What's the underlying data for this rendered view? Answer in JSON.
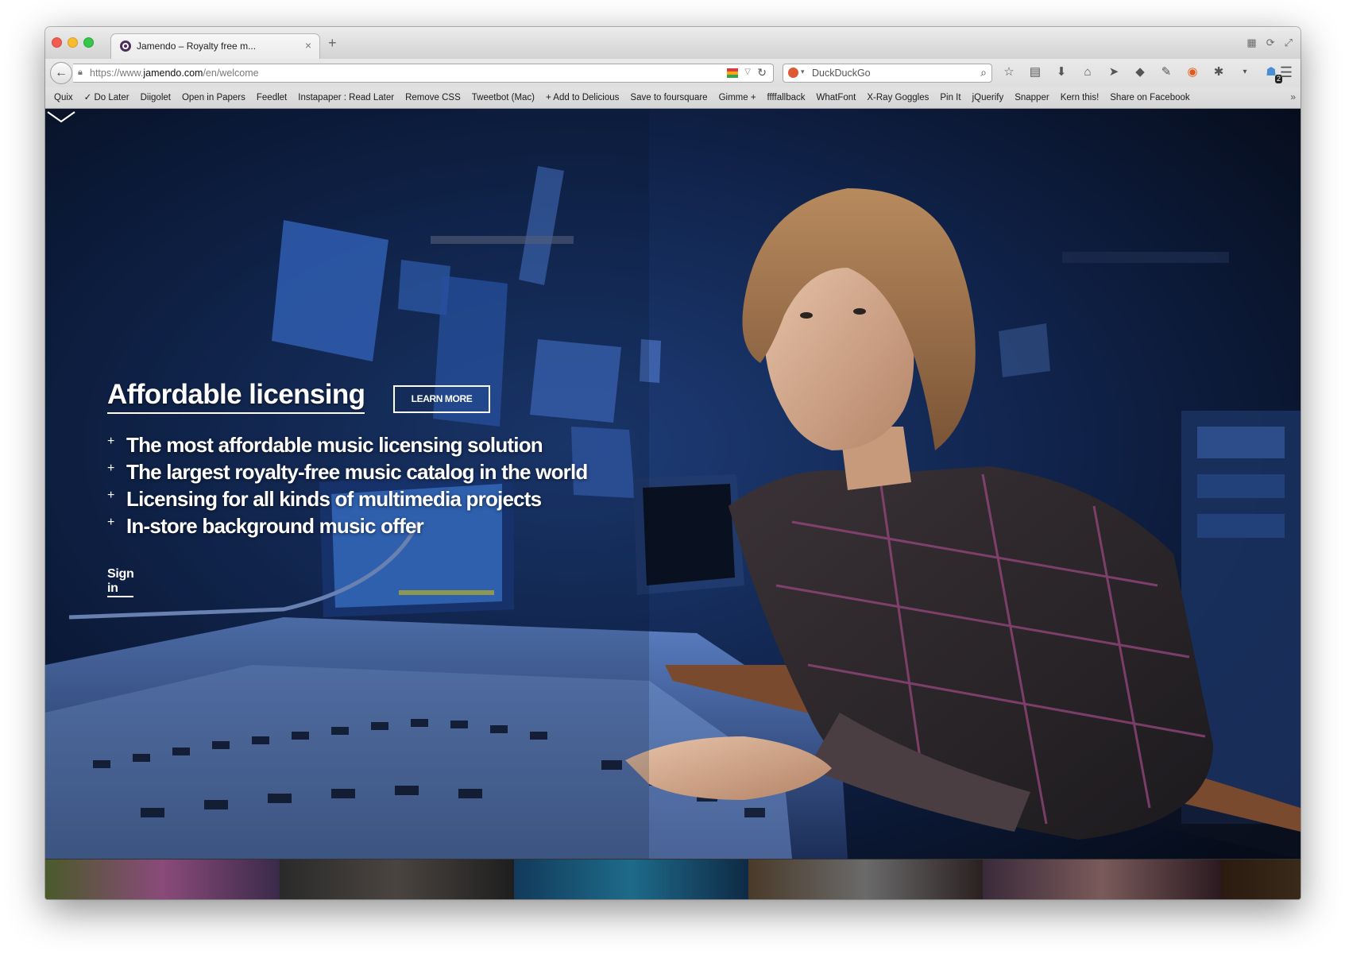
{
  "browser": {
    "tab": {
      "title": "Jamendo – Royalty free m...",
      "close": "×"
    },
    "new_tab": "+",
    "url": {
      "prefix": "https://www.",
      "domain": "jamendo.com",
      "path": "/en/welcome"
    },
    "search": {
      "engine": "DuckDuckGo",
      "placeholder": "DuckDuckGo"
    },
    "addon_badge_count": "2",
    "bookmarks": [
      "Quix",
      "✓ Do Later",
      "Diigolet",
      "Open in Papers",
      "Feedlet",
      "Instapaper : Read Later",
      "Remove CSS",
      "Tweetbot (Mac)",
      "+ Add to Delicious",
      "Save to foursquare",
      "Gimme +",
      "ffffallback",
      "WhatFont",
      "X-Ray Goggles",
      "Pin It",
      "jQuerify",
      "Snapper",
      "Kern this!",
      "Share on Facebook"
    ],
    "bookmarks_overflow": "»"
  },
  "hero": {
    "headline": "Affordable licensing",
    "learn_more": "LEARN MORE",
    "features": [
      "The most affordable music licensing solution",
      "The largest royalty-free music catalog in the world",
      "Licensing for all kinds of multimedia projects",
      "In-store background music offer"
    ],
    "bullet": "+",
    "sign_in": "Sign in"
  },
  "colors": {
    "hero_bg": "#0a1325",
    "text": "#ffffff",
    "tab_favicon": "#4b2d5c"
  }
}
